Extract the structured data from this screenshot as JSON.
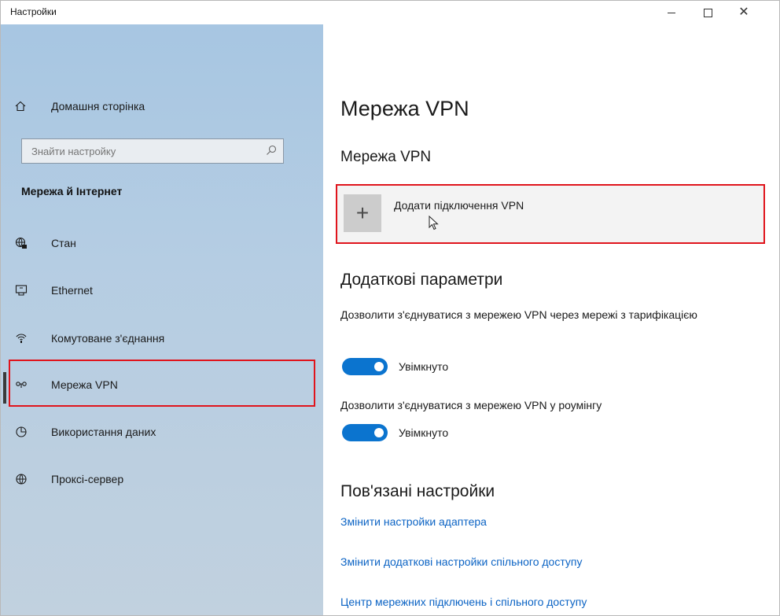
{
  "window": {
    "title": "Настройки"
  },
  "sidebar": {
    "home_label": "Домашня сторінка",
    "search_placeholder": "Знайти настройку",
    "section_heading": "Мережа й Інтернет",
    "items": [
      {
        "label": "Стан",
        "icon": "globe-status-icon"
      },
      {
        "label": "Ethernet",
        "icon": "ethernet-icon"
      },
      {
        "label": "Комутоване з'єднання",
        "icon": "dialup-icon"
      },
      {
        "label": "Мережа VPN",
        "icon": "vpn-icon",
        "selected": true
      },
      {
        "label": "Використання даних",
        "icon": "data-usage-icon"
      },
      {
        "label": "Проксі-сервер",
        "icon": "globe-icon"
      }
    ]
  },
  "main": {
    "title": "Мережа VPN",
    "subtitle": "Мережа VPN",
    "add_vpn_label": "Додати підключення VPN",
    "advanced_title": "Додаткові параметри",
    "settings": [
      {
        "label": "Дозволити з'єднуватися з мережею VPN через мережі з тарифікацією",
        "state": "Увімкнуто",
        "on": true
      },
      {
        "label": "Дозволити з'єднуватися з мережею VPN у роумінгу",
        "state": "Увімкнуто",
        "on": true
      }
    ],
    "related_title": "Пов'язані настройки",
    "links": [
      "Змінити настройки адаптера",
      "Змінити додаткові настройки спільного доступу",
      "Центр мережних підключень і спільного доступу"
    ]
  },
  "colors": {
    "accent": "#0b74cf",
    "link": "#0b63c4",
    "highlight": "#e0141c",
    "sidebar": "#b5cde3"
  }
}
